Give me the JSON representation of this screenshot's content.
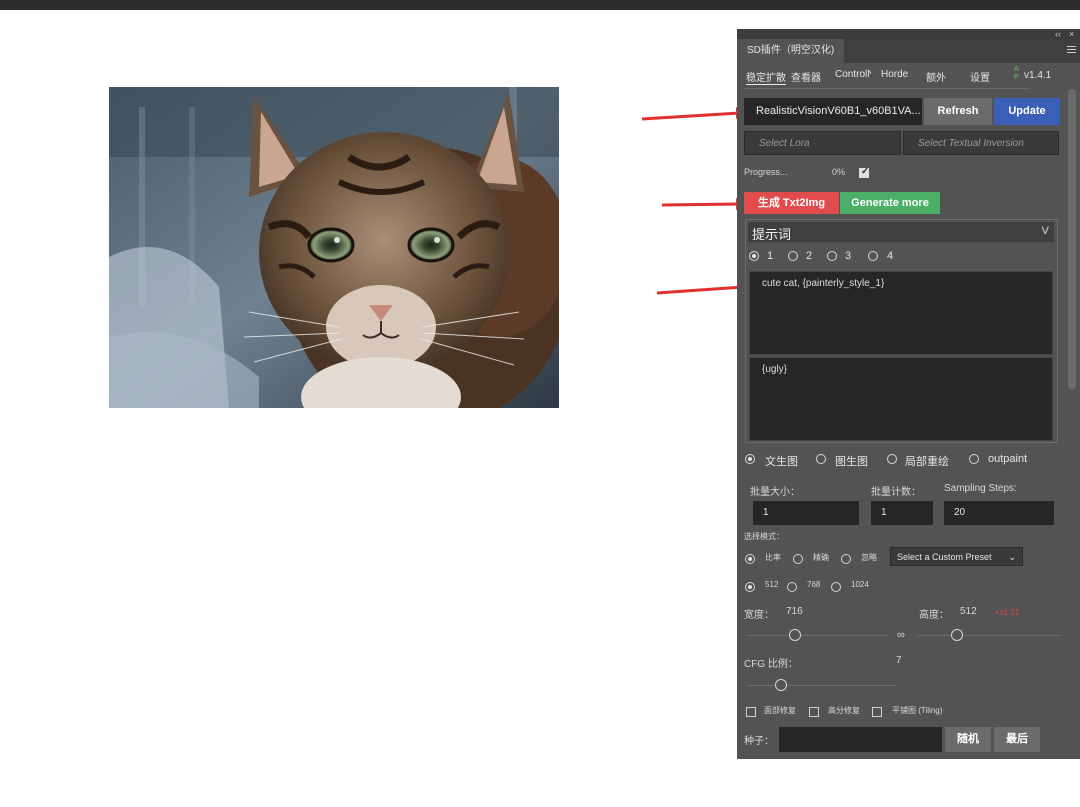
{
  "panel": {
    "tab_title": "SD插件（明空汉化)",
    "chrome_buttons": [
      "‹‹",
      "×"
    ]
  },
  "nav": {
    "tabs": [
      "稳定扩散",
      "查看器",
      "ControlNet",
      "Horde",
      "额外",
      "设置"
    ],
    "ap_badge": "A\nP",
    "version": "v1.4.1"
  },
  "model": {
    "selected": "RealisticVisionV60B1_v60B1VA...",
    "refresh_label": "Refresh",
    "update_label": "Update"
  },
  "lora": {
    "placeholder": "Select Lora"
  },
  "textual": {
    "placeholder": "Select Textual Inversion"
  },
  "progress": {
    "label": "Progress...",
    "value": "0%",
    "checked": true
  },
  "actions": {
    "generate_label": "生成 Txt2Img",
    "generate_more_label": "Generate more"
  },
  "prompt": {
    "section_title": "提示词",
    "chevron": "V",
    "slots": [
      "1",
      "2",
      "3",
      "4"
    ],
    "selected_slot": "1",
    "positive": "cute cat, {painterly_style_1}",
    "negative": "{ugly}"
  },
  "modes": {
    "options": [
      "文生图",
      "图生图",
      "局部重绘",
      "outpaint"
    ],
    "selected": "文生图"
  },
  "batch": {
    "size_label": "批量大小：",
    "size_value": "1",
    "count_label": "批量计数：",
    "count_value": "1",
    "steps_label": "Sampling Steps:",
    "steps_value": "20"
  },
  "select_mode": {
    "label": "选择模式：",
    "options": [
      "比率",
      "精确",
      "忽略"
    ],
    "selected": "比率",
    "preset_label": "Select a Custom Preset",
    "preset_chevron": "⌄"
  },
  "resolutions": {
    "options": [
      "512",
      "768",
      "1024"
    ],
    "selected": "512"
  },
  "size": {
    "width_label": "宽度：",
    "width_value": "716",
    "height_label": "高度：",
    "height_value": "512",
    "ratio_text": "+x1.21",
    "ratio_color": "#e04b4b",
    "link_icon": "∞"
  },
  "cfg": {
    "label": "CFG 比例：",
    "value": "7"
  },
  "toggles": {
    "options": [
      "面部修复",
      "高分修复",
      "平铺图 (Tiling)"
    ]
  },
  "seed": {
    "label": "种子：",
    "value": "",
    "random_label": "随机",
    "last_label": "最后"
  },
  "colors": {
    "refresh": "#6b6b6b",
    "update": "#3b5fb8",
    "generate": "#e14b4b",
    "generate_more": "#4caf68",
    "arrow": "#e03030"
  }
}
